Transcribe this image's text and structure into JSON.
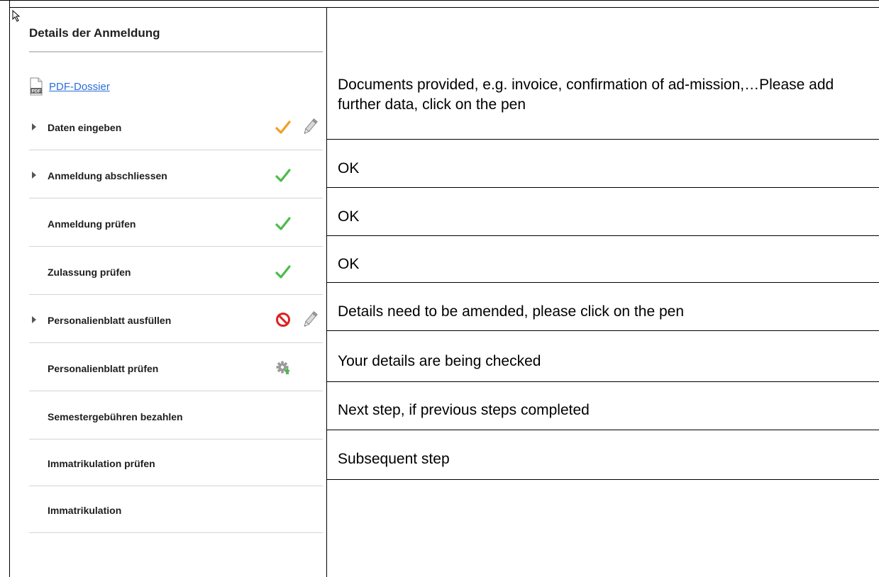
{
  "panel": {
    "title": "Details der Anmeldung",
    "pdf_link": "PDF-Dossier",
    "steps": [
      {
        "label": "Daten eingeben",
        "expandable": true,
        "status": "partial",
        "editable": true
      },
      {
        "label": "Anmeldung abschliessen",
        "expandable": true,
        "status": "done",
        "editable": false
      },
      {
        "label": "Anmeldung prüfen",
        "expandable": false,
        "status": "done",
        "editable": false
      },
      {
        "label": "Zulassung prüfen",
        "expandable": false,
        "status": "done",
        "editable": false
      },
      {
        "label": "Personalienblatt ausfüllen",
        "expandable": true,
        "status": "blocked",
        "editable": true
      },
      {
        "label": "Personalienblatt prüfen",
        "expandable": false,
        "status": "processing",
        "editable": false
      },
      {
        "label": "Semestergebühren bezahlen",
        "expandable": false,
        "status": "none",
        "editable": false
      },
      {
        "label": "Immatrikulation prüfen",
        "expandable": false,
        "status": "none",
        "editable": false
      },
      {
        "label": "Immatrikulation",
        "expandable": false,
        "status": "none",
        "editable": false
      }
    ]
  },
  "descriptions": [
    "Documents provided, e.g. invoice, confirmation of ad-mission,…Please add further data, click on the pen",
    "OK",
    "OK",
    "OK",
    "Details need to be amended, please click on the pen",
    "Your details are being checked",
    "Next step, if previous steps completed",
    "Subsequent step"
  ],
  "colors": {
    "check_green": "#4cbb4c",
    "check_orange": "#f0a020",
    "blocked_red": "#e02020",
    "link_blue": "#2a6fd8"
  }
}
